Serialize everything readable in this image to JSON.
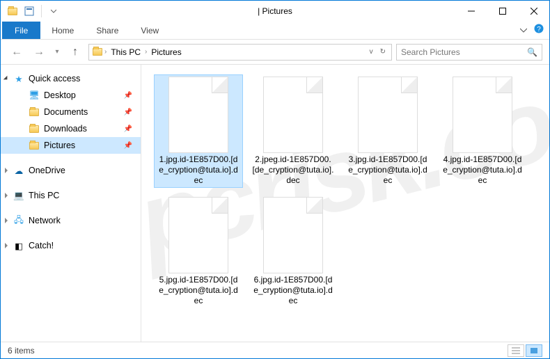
{
  "window": {
    "title": "Pictures",
    "title_sep": " | "
  },
  "ribbon": {
    "file": "File",
    "tabs": [
      "Home",
      "Share",
      "View"
    ]
  },
  "breadcrumb": {
    "parts": [
      "This PC",
      "Pictures"
    ]
  },
  "search": {
    "placeholder": "Search Pictures"
  },
  "nav": {
    "quick_access": "Quick access",
    "pinned": [
      "Desktop",
      "Documents",
      "Downloads",
      "Pictures"
    ],
    "onedrive": "OneDrive",
    "this_pc": "This PC",
    "network": "Network",
    "catch": "Catch!"
  },
  "files": [
    {
      "name": "1.jpg.id-1E857D00.[de_cryption@tuta.io].dec",
      "selected": true
    },
    {
      "name": "2.jpeg.id-1E857D00.[de_cryption@tuta.io].dec",
      "selected": false
    },
    {
      "name": "3.jpg.id-1E857D00.[de_cryption@tuta.io].dec",
      "selected": false
    },
    {
      "name": "4.jpg.id-1E857D00.[de_cryption@tuta.io].dec",
      "selected": false
    },
    {
      "name": "5.jpg.id-1E857D00.[de_cryption@tuta.io].dec",
      "selected": false
    },
    {
      "name": "6.jpg.id-1E857D00.[de_cryption@tuta.io].dec",
      "selected": false
    }
  ],
  "status": {
    "count": "6 items"
  },
  "watermark": "pcrisk.com"
}
